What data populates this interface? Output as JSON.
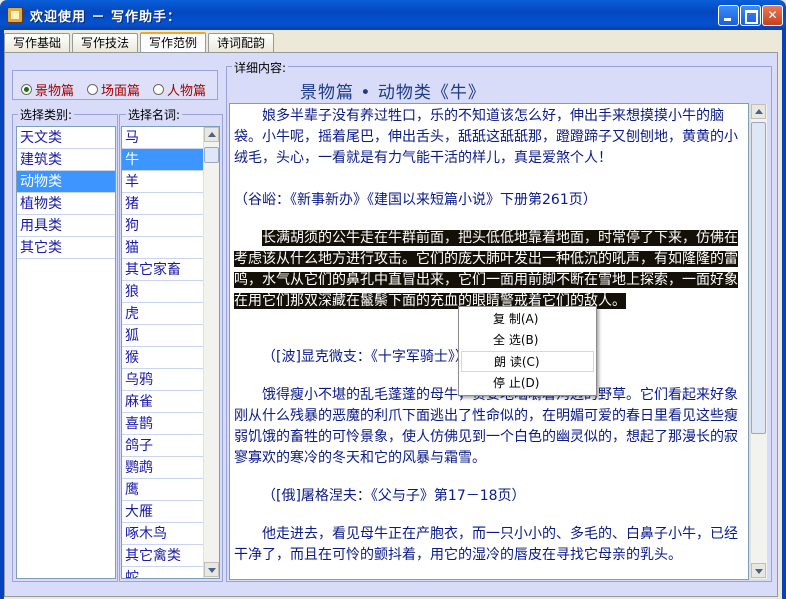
{
  "window": {
    "title": "欢迎使用 － 写作助手："
  },
  "tabs": [
    {
      "label": "写作基础"
    },
    {
      "label": "写作技法"
    },
    {
      "label": "写作范例"
    },
    {
      "label": "诗词配韵"
    }
  ],
  "radios": [
    {
      "label": "景物篇",
      "checked": true
    },
    {
      "label": "场面篇",
      "checked": false
    },
    {
      "label": "人物篇",
      "checked": false
    }
  ],
  "category": {
    "label": "选择类别:",
    "items": [
      "天文类",
      "建筑类",
      "动物类",
      "植物类",
      "用具类",
      "其它类"
    ],
    "selected": "动物类"
  },
  "names": {
    "label": "选择名词:",
    "items": [
      "马",
      "牛",
      "羊",
      "猪",
      "狗",
      "猫",
      "其它家畜",
      "狼",
      "虎",
      "狐",
      "猴",
      "乌鸦",
      "麻雀",
      "喜鹊",
      "鸽子",
      "鹦鹉",
      "鹰",
      "大雁",
      "啄木鸟",
      "其它禽类",
      "蛇"
    ],
    "selected": "牛"
  },
  "detail": {
    "label": "详细内容:",
    "title": "景物篇 • 动物类《牛》",
    "paragraphs": [
      "娘多半辈子没有养过牲口，乐的不知道该怎么好，伸出手来想摸摸小牛的脑袋。小牛呢，摇着尾巴，伸出舌头，舐舐这舐舐那，蹬蹬蹄子又刨刨地，黄黄的小绒毛，头心，一看就是有力气能干活的样儿，真是爱煞个人！",
      "（谷峪：《新事新办》《建国以来短篇小说》下册第261页）",
      "长满胡须的公牛走在牛群前面，把头低低地靠着地面，时常停了下来，仿佛在考虑该从什么地方进行攻击。它们的庞大肺叶发出一种低沉的吼声，有如隆隆的雷鸣，水气从它们的鼻孔中直冒出来，它们一面用前脚不断在雪地上探索，一面好象在用它们那双深藏在鬣鬃下面的充血的眼睛警戒着它们的敌人。",
      "（[波]显克微支：《十字军骑士》）",
      "饿得瘦小不堪的乱毛蓬蓬的母牛，贪婪地啮嚼着沟边的野草。它们看起来好象刚从什么残暴的恶魔的利爪下面逃出了性命似的，在明媚可爱的春日里看见这些瘦弱饥饿的畜牲的可怜景象，使人仿佛见到一个白色的幽灵似的，想起了那漫长的寂寥寡欢的寒冷的冬天和它的风暴与霜雪。",
      "（[俄]屠格涅夫：《父与子》第17－18页）",
      "他走进去，看见母牛正在产胞衣，而一只小小的、多毛的、白鼻子小牛，已经干净了，而且在可怜的颤抖着，用它的湿冷的唇皮在寻找它母亲的乳头。"
    ]
  },
  "context_menu": {
    "items": [
      "复  制(A)",
      "全  选(B)",
      "朗  读(C)",
      "停  止(D)"
    ],
    "hovered": "朗  读(C)"
  }
}
